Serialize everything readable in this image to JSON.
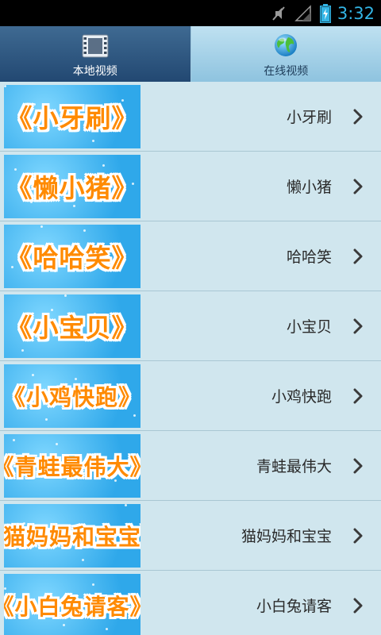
{
  "status_bar": {
    "time": "3:32",
    "icons": [
      "mute-icon",
      "signal-icon",
      "battery-charging-icon"
    ]
  },
  "tabs": [
    {
      "label": "本地视频",
      "icon": "film-icon",
      "selected": true
    },
    {
      "label": "在线视频",
      "icon": "globe-icon",
      "selected": false
    }
  ],
  "videos": [
    {
      "thumb": "《小牙刷》",
      "title": "小牙刷"
    },
    {
      "thumb": "《懒小猪》",
      "title": "懒小猪"
    },
    {
      "thumb": "《哈哈笑》",
      "title": "哈哈笑"
    },
    {
      "thumb": "《小宝贝》",
      "title": "小宝贝"
    },
    {
      "thumb": "《小鸡快跑》",
      "title": "小鸡快跑"
    },
    {
      "thumb": "《青蛙最伟大》",
      "title": "青蛙最伟大"
    },
    {
      "thumb": "《猫妈妈和宝宝》",
      "title": "猫妈妈和宝宝"
    },
    {
      "thumb": "《小白兔请客》",
      "title": "小白兔请客"
    }
  ],
  "colors": {
    "status_time": "#33b5e5",
    "tab_selected": "#224872",
    "tab_unselected": "#8ec3df",
    "row_background": "#d0e6ee",
    "thumb_text": "#ff8a00"
  }
}
